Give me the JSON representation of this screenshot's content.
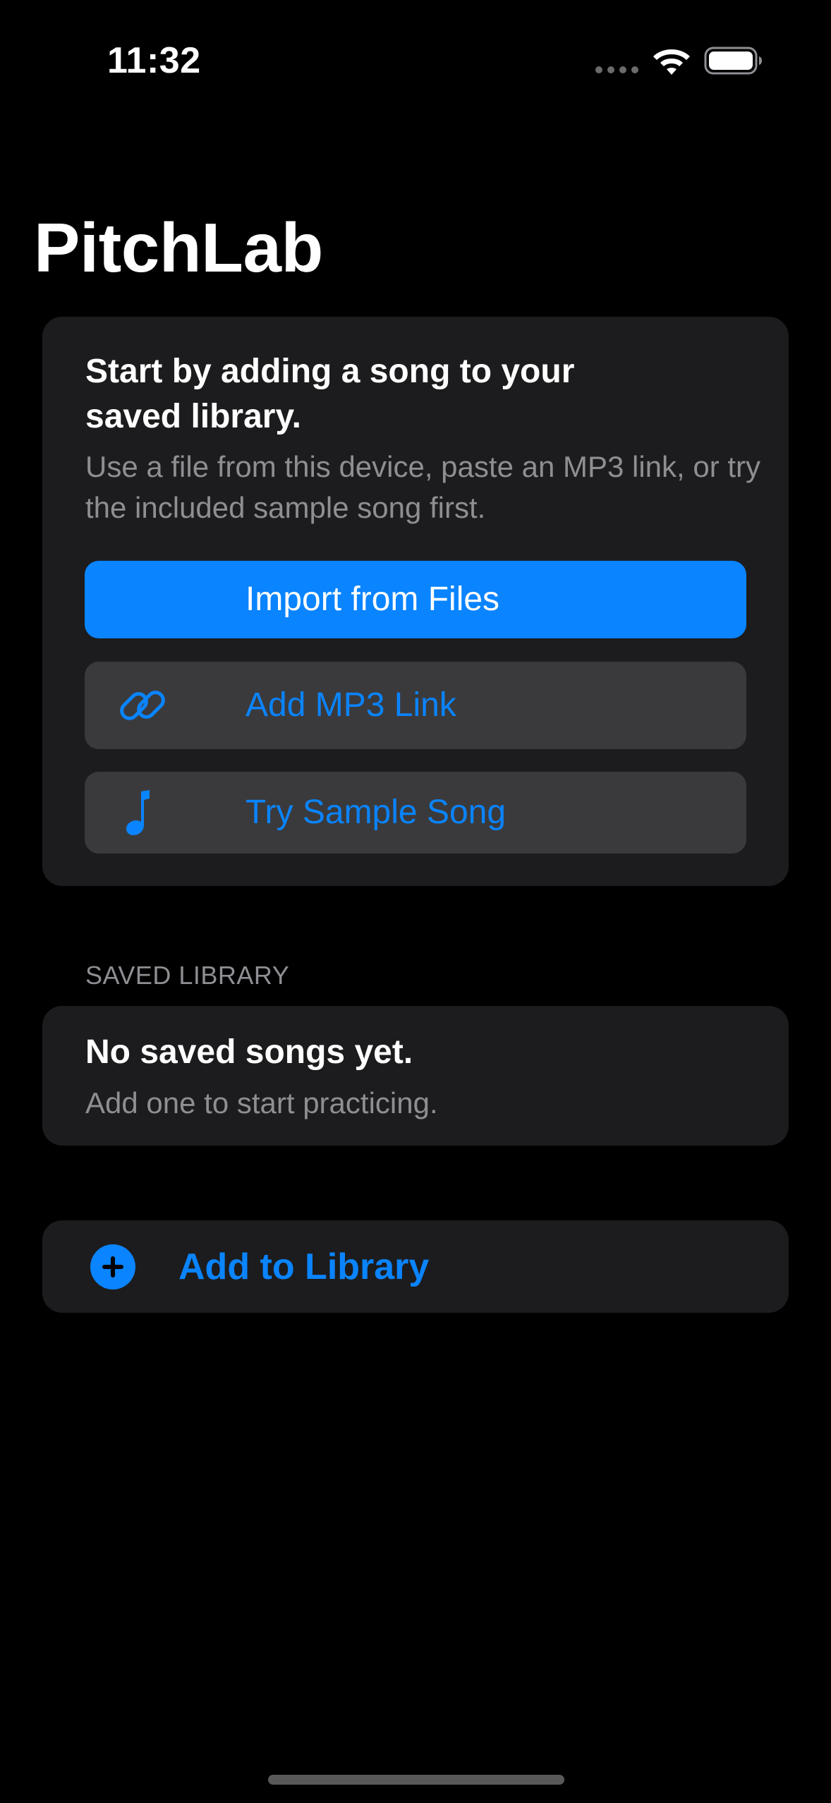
{
  "status_bar": {
    "time": "11:32",
    "icons": [
      "signal-dots-icon",
      "wifi-icon",
      "battery-icon"
    ]
  },
  "app": {
    "title": "PitchLab"
  },
  "intro": {
    "heading": "Start by adding a song to your saved library.",
    "subtitle": "Use a file from this device, paste an MP3 link, or try the included sample song first.",
    "buttons": {
      "import_files": "Import from Files",
      "add_mp3_link": "Add MP3 Link",
      "try_sample": "Try Sample Song"
    },
    "icons": {
      "add_mp3_link": "link-icon",
      "try_sample": "music-note-icon"
    }
  },
  "library": {
    "section_header": "SAVED LIBRARY",
    "empty_title": "No saved songs yet.",
    "empty_subtitle": "Add one to start practicing.",
    "add_button": "Add to Library",
    "add_icon": "plus-circle-icon"
  },
  "colors": {
    "background": "#000000",
    "card": "#1c1c1e",
    "secondary_button": "#3a3a3c",
    "accent": "#0a84ff",
    "secondary_text": "#8e8e93"
  }
}
